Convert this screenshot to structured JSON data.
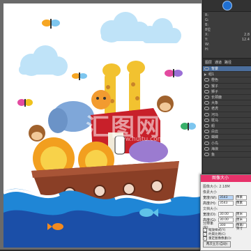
{
  "app": {
    "name": "Photoshop"
  },
  "watermark": {
    "text": "汇图网",
    "sub": "www.huitu.com"
  },
  "info_panel": {
    "rows": [
      {
        "k": "R:",
        "v": ""
      },
      {
        "k": "G:",
        "v": ""
      },
      {
        "k": "B:",
        "v": ""
      },
      {
        "k": "8位",
        "v": ""
      },
      {
        "k": "X:",
        "v": "2.8"
      },
      {
        "k": "Y:",
        "v": "12.4"
      },
      {
        "k": "W:",
        "v": ""
      },
      {
        "k": "H:",
        "v": ""
      }
    ]
  },
  "layers": {
    "tabs": [
      "图层",
      "通道",
      "路径"
    ],
    "items": [
      {
        "name": "背景",
        "selected": true
      },
      {
        "name": "组1"
      },
      {
        "name": "橙色"
      },
      {
        "name": "猴子"
      },
      {
        "name": "狮子"
      },
      {
        "name": "长颈鹿"
      },
      {
        "name": "大象"
      },
      {
        "name": "老虎"
      },
      {
        "name": "河马"
      },
      {
        "name": "斑马"
      },
      {
        "name": "船"
      },
      {
        "name": "白云"
      },
      {
        "name": "蝴蝶"
      },
      {
        "name": "小鸟"
      },
      {
        "name": "海浪"
      },
      {
        "name": "鱼"
      }
    ]
  },
  "dialog": {
    "title": "图像大小",
    "size_line": "图像大小: 2.18M",
    "pixel_section": "像素大小",
    "width_label": "宽度(W):",
    "width_value": "3543",
    "width_unit": "像素",
    "height_label": "高度(H):",
    "height_value": "3543",
    "height_unit": "像素",
    "doc_section": "文档大小:",
    "doc_width_label": "宽度(D):",
    "doc_width_value": "30.00",
    "doc_width_unit": "厘米",
    "doc_height_label": "高度(G):",
    "doc_height_value": "30.00",
    "doc_height_unit": "厘米",
    "res_label": "分辨率(R):",
    "res_value": "300",
    "res_unit": "像素/英寸",
    "check1": "缩放样式(Y)",
    "check2": "约束比例(C)",
    "check3": "重定图像像素(I):",
    "button": "两次立方(自动)"
  }
}
